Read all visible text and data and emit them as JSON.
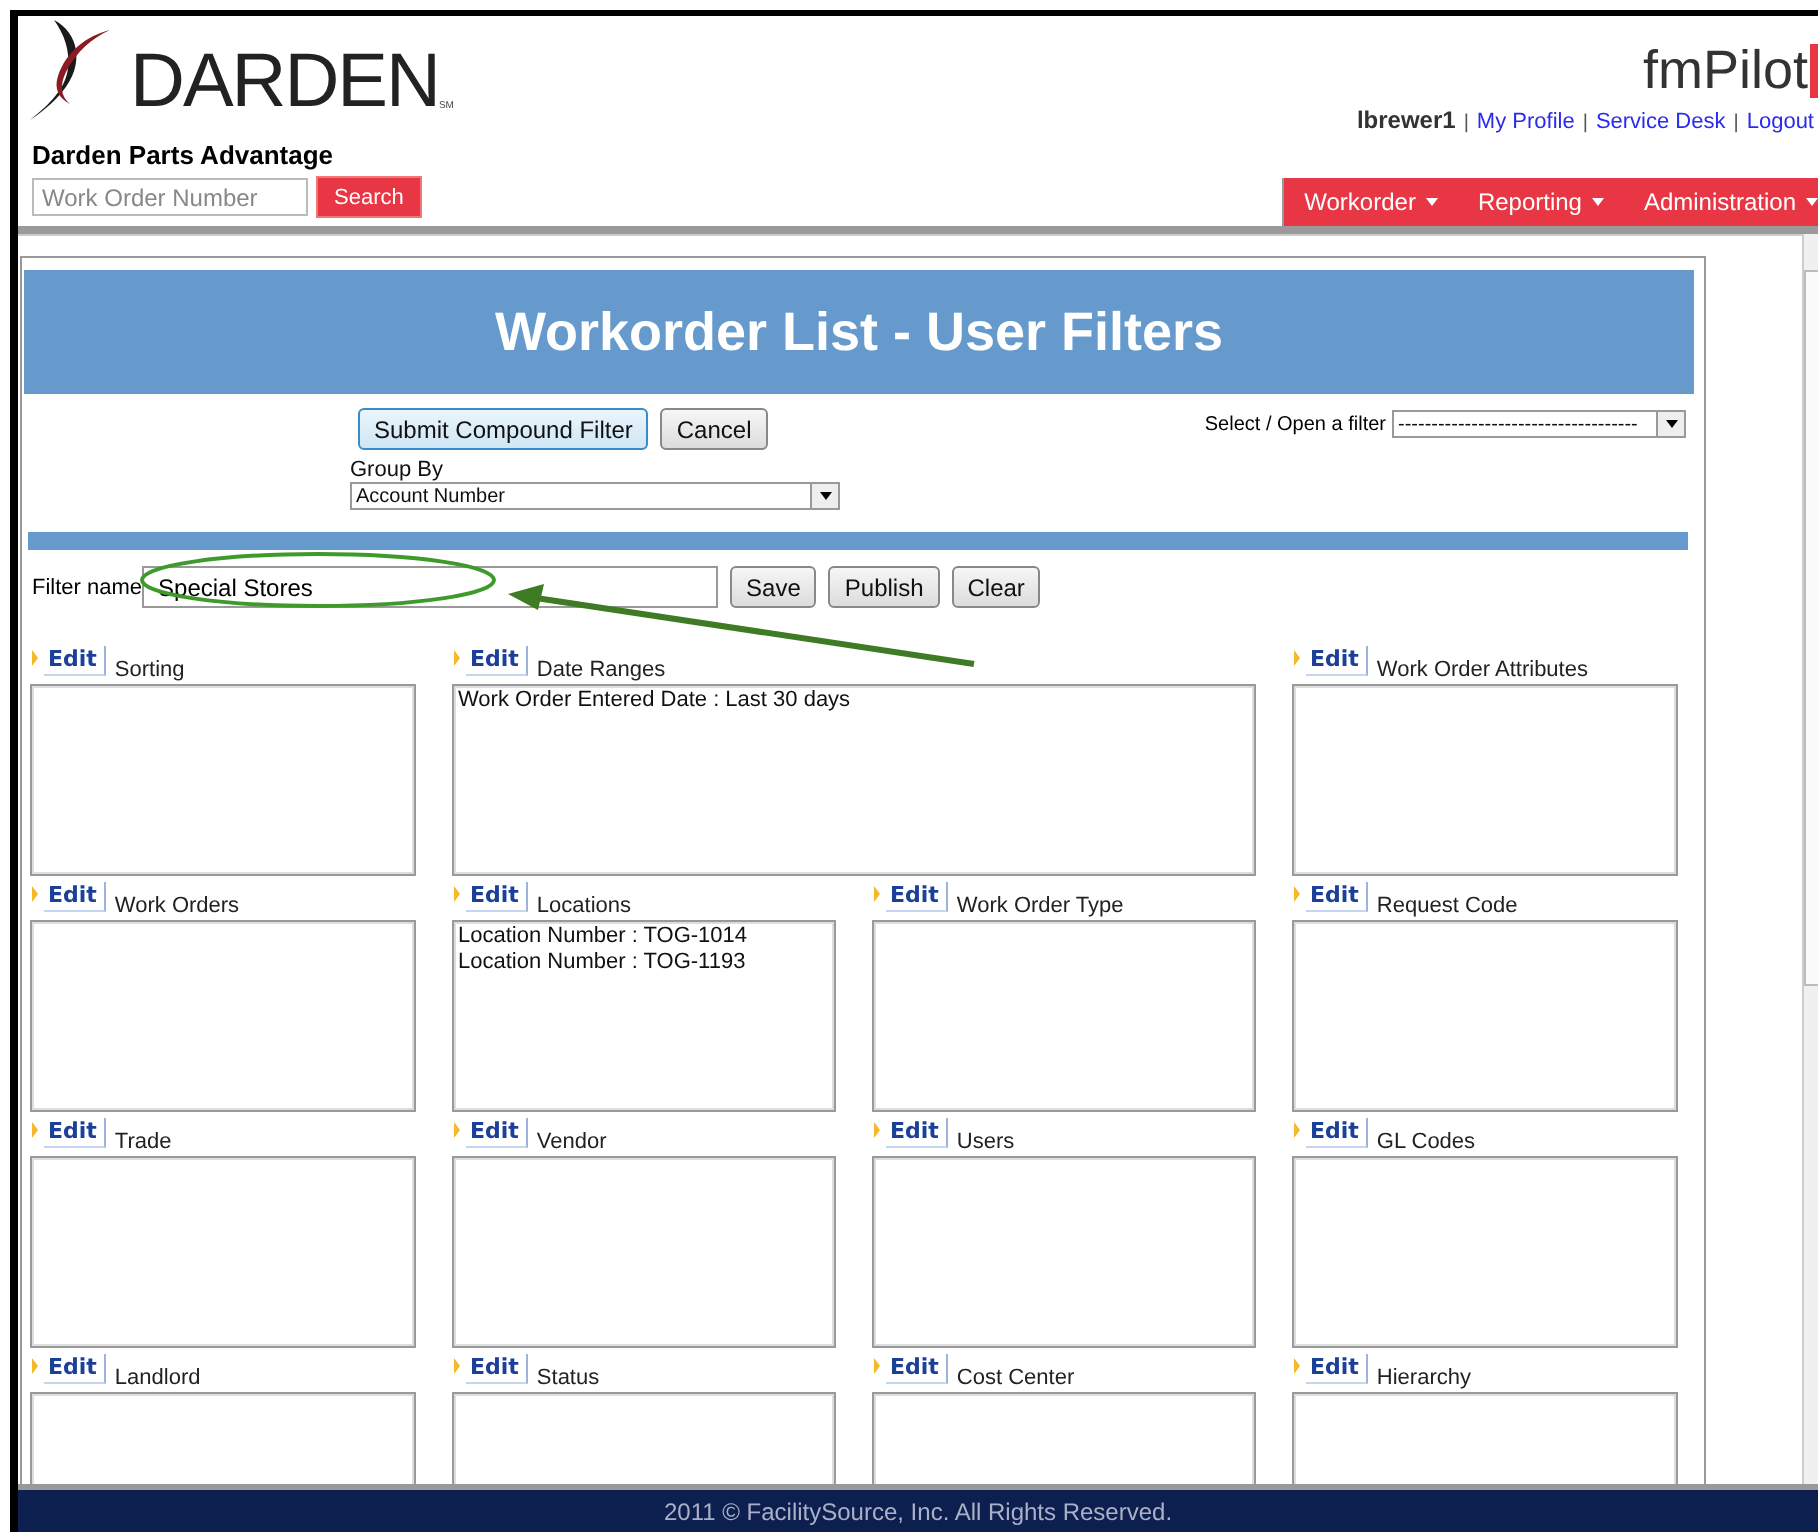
{
  "header": {
    "brand": "DARDEN",
    "brand_mark": "SM",
    "site_name": "Darden Parts Advantage",
    "search": {
      "placeholder": "Work Order Number",
      "button": "Search"
    },
    "product_logo": "fmPilot",
    "user_links": [
      {
        "label": "lbrewer1",
        "kind": "user",
        "separator": "|"
      },
      {
        "label": "My Profile",
        "kind": "link",
        "separator": "|"
      },
      {
        "label": "Service Desk",
        "kind": "link",
        "separator": "|"
      },
      {
        "label": "Logout",
        "kind": "link"
      }
    ],
    "nav": [
      {
        "label": "Workorder"
      },
      {
        "label": "Reporting"
      },
      {
        "label": "Administration"
      }
    ]
  },
  "page": {
    "title": "Workorder List - User Filters",
    "actions": [
      "Submit Compound Filter",
      "Cancel"
    ],
    "group_by": {
      "label": "Group By",
      "value": "Account Number"
    },
    "open_filter": {
      "label": "Select / Open a filter",
      "value": "------------------------------------"
    },
    "filter_name": {
      "label": "Filter name",
      "value": "Special Stores",
      "buttons": [
        "Save",
        "Publish",
        "Clear"
      ]
    },
    "sections": [
      {
        "title": "Sorting",
        "edit": "Edit",
        "wide": false
      },
      {
        "title": "Date Ranges",
        "edit": "Edit",
        "wide": true,
        "entries": [
          "Work Order Entered Date : Last 30 days"
        ]
      },
      {
        "title": "Work Order Attributes",
        "edit": "Edit",
        "wide": false
      },
      {
        "title": "Work Orders",
        "edit": "Edit",
        "wide": false
      },
      {
        "title": "Locations",
        "edit": "Edit",
        "wide": false,
        "entries": [
          "Location Number : TOG-1014",
          "Location Number : TOG-1193"
        ]
      },
      {
        "title": "Work Order Type",
        "edit": "Edit",
        "wide": false
      },
      {
        "title": "Request Code",
        "edit": "Edit",
        "wide": false
      },
      {
        "title": "Trade",
        "edit": "Edit",
        "wide": false
      },
      {
        "title": "Vendor",
        "edit": "Edit",
        "wide": false
      },
      {
        "title": "Users",
        "edit": "Edit",
        "wide": false
      },
      {
        "title": "GL Codes",
        "edit": "Edit",
        "wide": false
      },
      {
        "title": "Landlord",
        "edit": "Edit",
        "wide": false
      },
      {
        "title": "Status",
        "edit": "Edit",
        "wide": false
      },
      {
        "title": "Cost Center",
        "edit": "Edit",
        "wide": false
      },
      {
        "title": "Hierarchy",
        "edit": "Edit",
        "wide": false
      }
    ]
  },
  "footer": {
    "text": "2011 © FacilitySource, Inc. All Rights Reserved."
  }
}
